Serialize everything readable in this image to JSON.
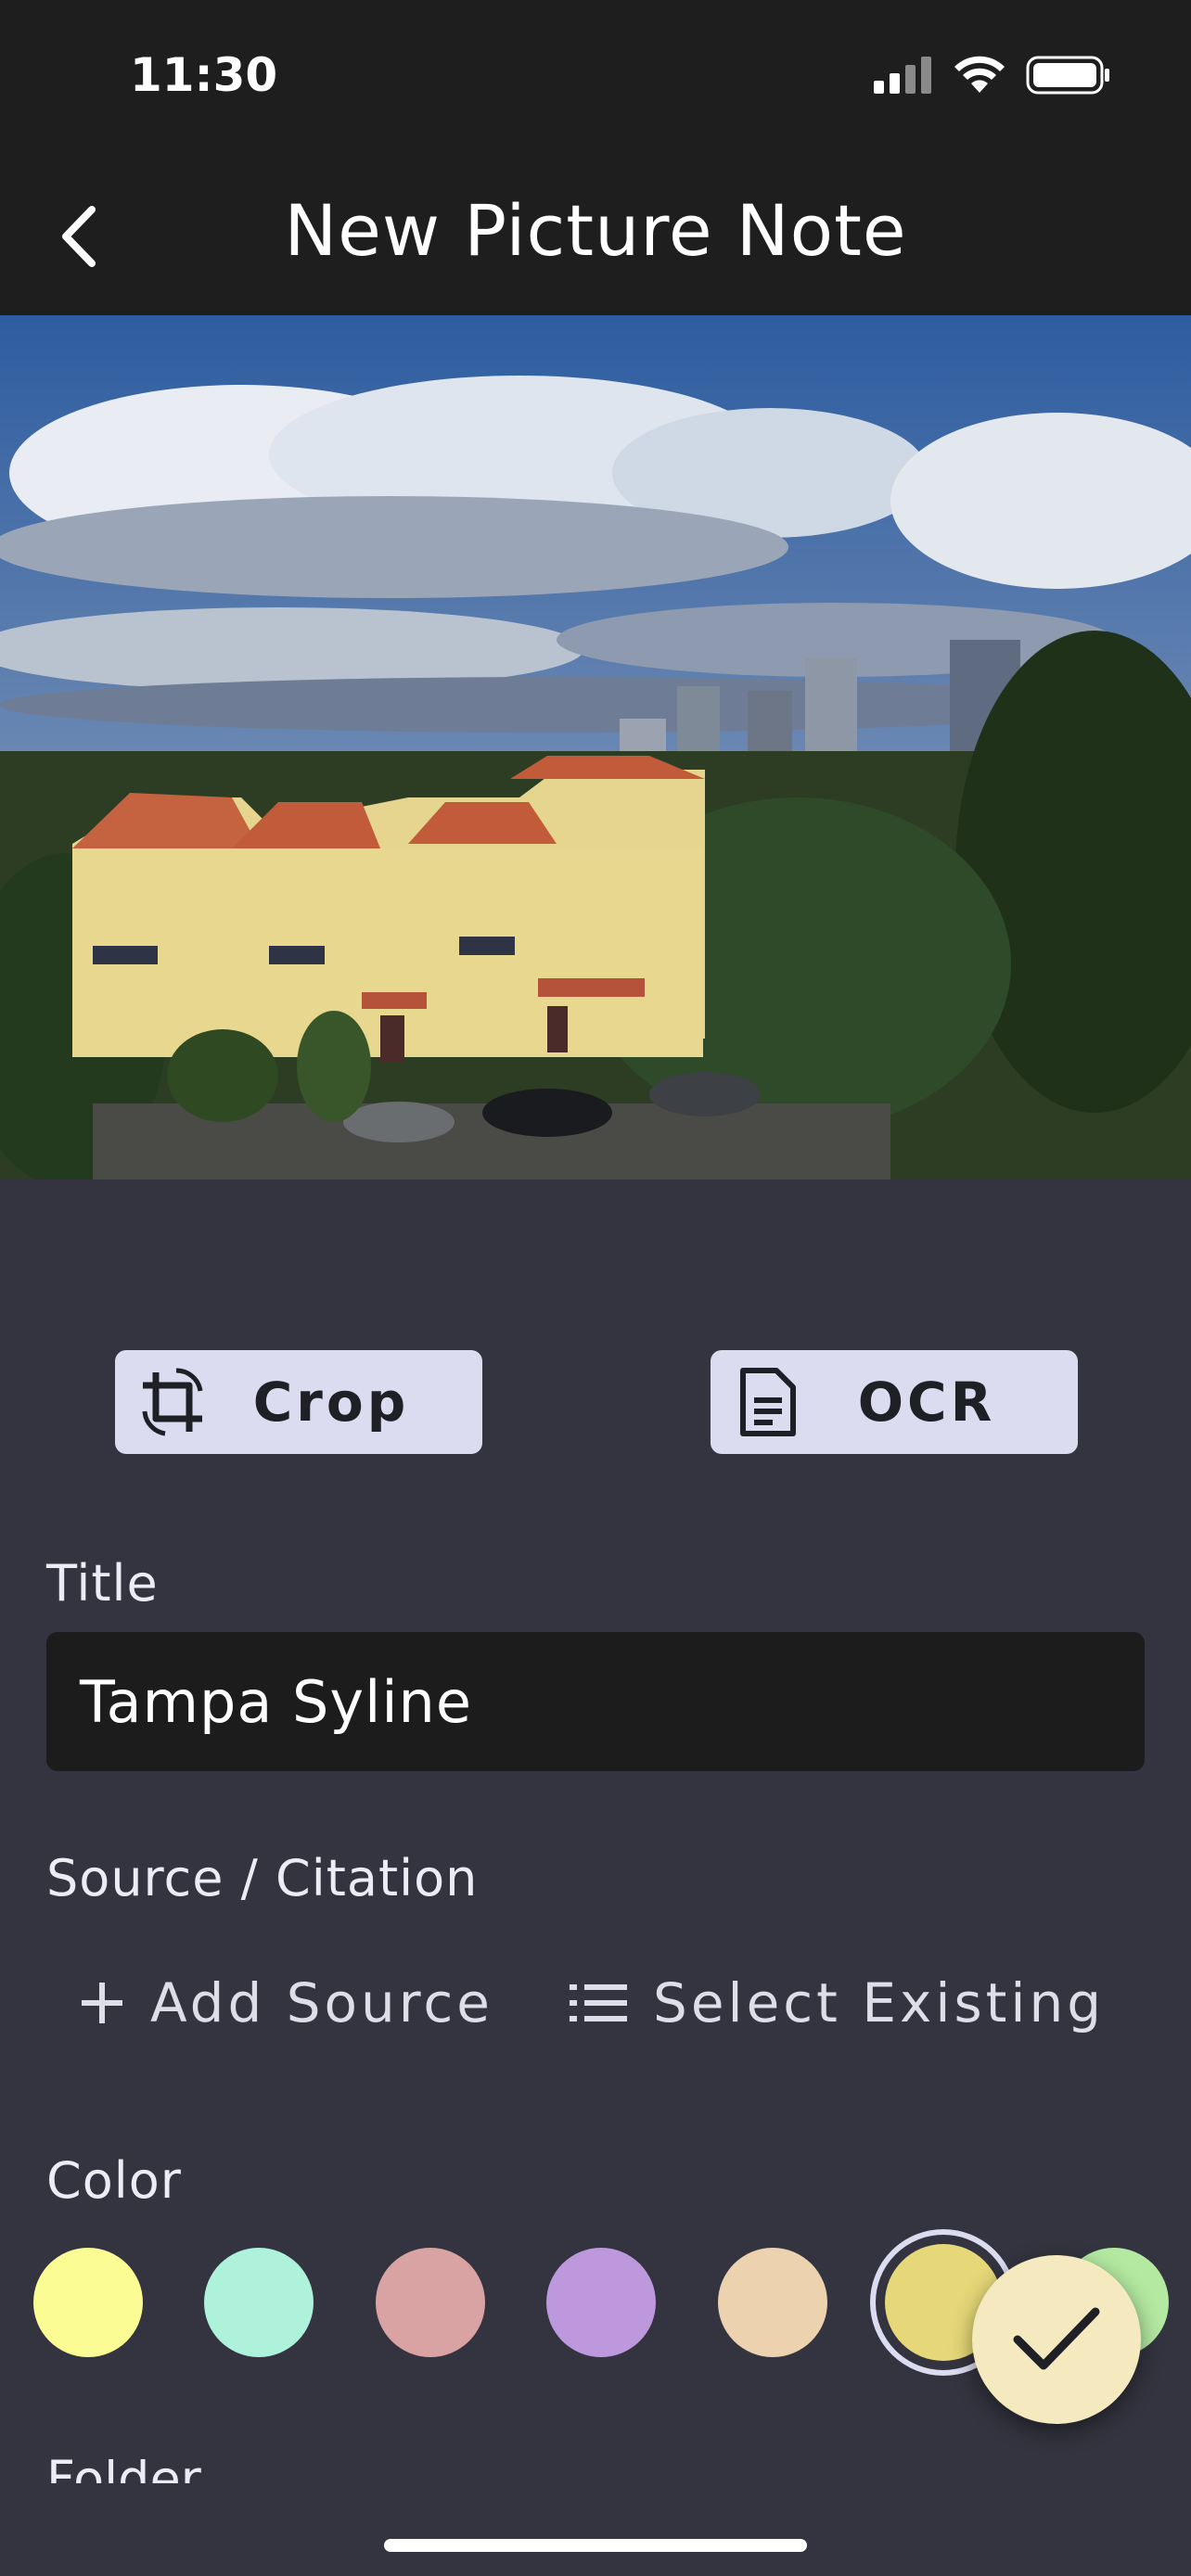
{
  "status_bar": {
    "time": "11:30"
  },
  "app_bar": {
    "title": "New Picture Note",
    "back_icon": "chevron-left-icon"
  },
  "photo": {
    "description_icon": "photo"
  },
  "actions": {
    "crop": {
      "label": "Crop",
      "icon": "crop-icon"
    },
    "ocr": {
      "label": "OCR",
      "icon": "document-icon"
    }
  },
  "title_field": {
    "label": "Title",
    "value": "Tampa Syline"
  },
  "source": {
    "label": "Source / Citation",
    "add_label": "Add Source",
    "select_label": "Select Existing"
  },
  "color": {
    "label": "Color",
    "swatches": [
      "#fbfc94",
      "#aef2dc",
      "#d9a3a3",
      "#be98dc",
      "#ecd2ae",
      "#e6d878",
      "#b4e9a1"
    ],
    "selected": "#e6d878"
  },
  "folder": {
    "label": "Folder"
  }
}
